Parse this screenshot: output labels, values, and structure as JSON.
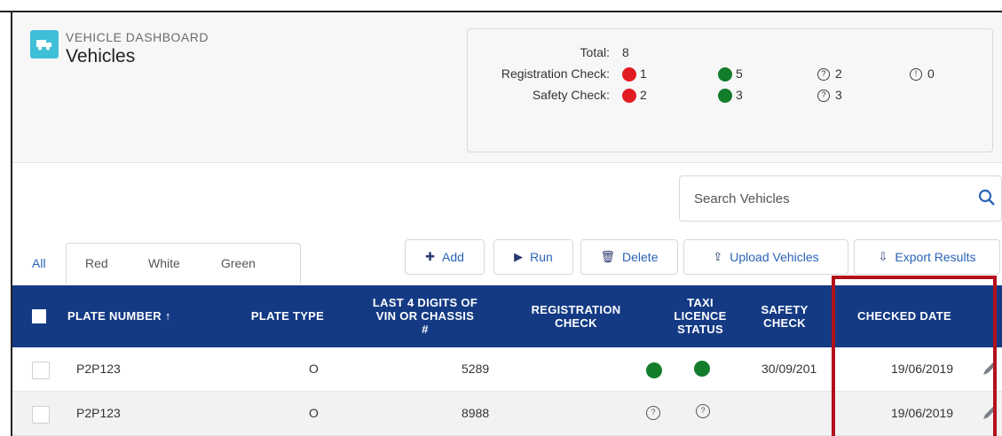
{
  "header": {
    "eyebrow": "VEHICLE DASHBOARD",
    "title": "Vehicles",
    "app_icon": "truck-icon"
  },
  "summary": {
    "total_label": "Total:",
    "total_value": "8",
    "registration_label": "Registration Check:",
    "safety_label": "Safety Check:",
    "registration": {
      "red": "1",
      "green": "5",
      "unknown": "2",
      "info": "0"
    },
    "safety": {
      "red": "2",
      "green": "3",
      "unknown": "3"
    },
    "colors": {
      "red": "#e21b23",
      "green": "#147d2b"
    }
  },
  "search": {
    "placeholder": "Search Vehicles",
    "icon": "search-icon"
  },
  "tabs": [
    "All",
    "Red",
    "White",
    "Green"
  ],
  "toolbar": {
    "add": "Add",
    "run": "Run",
    "delete": "Delete",
    "upload": "Upload Vehicles",
    "export": "Export Results"
  },
  "table": {
    "columns": {
      "plate_number": "PLATE NUMBER ↑",
      "plate_type": "PLATE TYPE",
      "vin_line1": "LAST 4 DIGITS OF",
      "vin_line2": "VIN OR CHASSIS",
      "vin_line3": "#",
      "reg_line1": "REGISTRATION",
      "reg_line2": "CHECK",
      "taxi_line1": "TAXI",
      "taxi_line2": "LICENCE",
      "taxi_line3": "STATUS",
      "safety_line1": "SAFETY",
      "safety_line2": "CHECK",
      "checked_date": "CHECKED DATE"
    },
    "rows": [
      {
        "plate": "P2P123",
        "type": "O",
        "vin": "5289",
        "safety": "30/09/201",
        "checked": "19/06/2019"
      },
      {
        "plate": "P2P123",
        "type": "O",
        "vin": "8988",
        "safety": "",
        "checked": "19/06/2019"
      }
    ],
    "header_color": "#143a84"
  },
  "highlight_color": "#b2111b"
}
